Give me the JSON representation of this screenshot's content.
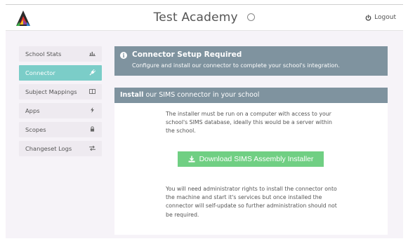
{
  "header": {
    "title": "Test",
    "subtitle": "Academy",
    "logout_label": "Logout",
    "icons": [
      "logo-icon",
      "status-circle-icon",
      "power-icon"
    ]
  },
  "sidebar": {
    "items": [
      {
        "label": "School Stats",
        "icon": "bar-chart-icon",
        "active": false
      },
      {
        "label": "Connector",
        "icon": "plug-icon",
        "active": true
      },
      {
        "label": "Subject Mappings",
        "icon": "columns-icon",
        "active": false
      },
      {
        "label": "Apps",
        "icon": "bolt-icon",
        "active": false
      },
      {
        "label": "Scopes",
        "icon": "lock-icon",
        "active": false
      },
      {
        "label": "Changeset Logs",
        "icon": "exchange-icon",
        "active": false
      }
    ]
  },
  "alert": {
    "title": "Connector Setup Required",
    "text": "Configure and install our connector to complete your school's integration.",
    "icon": "info-icon"
  },
  "panel": {
    "heading_bold": "Install",
    "heading_rest": " our SIMS connector in your school",
    "paragraph1": "The installer must be run on a computer with access to your school's SIMS database, ideally this would be a server within the school.",
    "download_label": "Download SIMS Assembly Installer",
    "paragraph2": "You will need administrator rights to install the connector onto the machine and start it's services but once installed the connector will self-update so further administration should not be required."
  },
  "colors": {
    "accent_teal": "#7bcdc8",
    "header_slate": "#7f939f",
    "download_green": "#70cf83"
  }
}
